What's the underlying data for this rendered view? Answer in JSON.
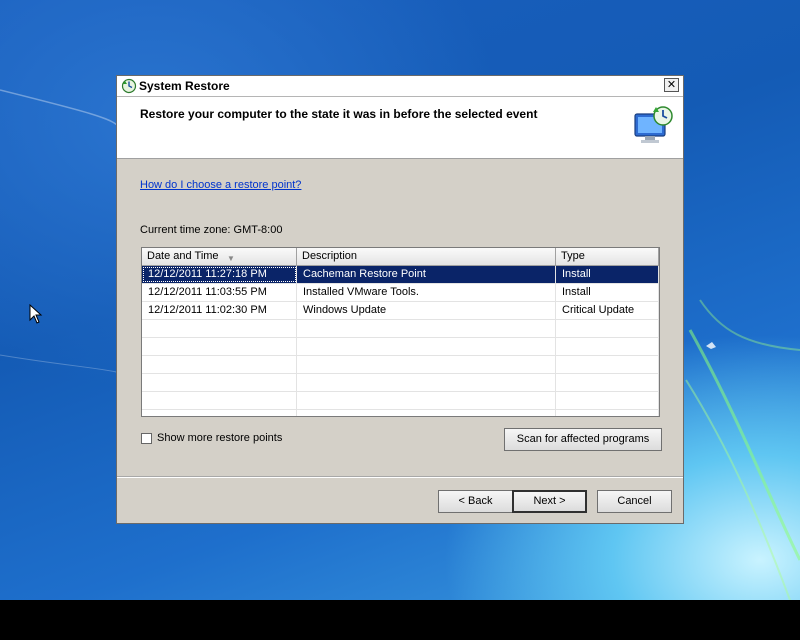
{
  "window": {
    "title": "System Restore",
    "close_label": "✕",
    "header_text": "Restore your computer to the state it was in before the selected event",
    "help_link": "How do I choose a restore point?",
    "timezone": "Current time zone: GMT-8:00"
  },
  "table": {
    "columns": [
      "Date and Time",
      "Description",
      "Type"
    ],
    "rows": [
      [
        "12/12/2011 11:27:18 PM",
        "Cacheman Restore Point",
        "Install"
      ],
      [
        "12/12/2011 11:03:55 PM",
        "Installed VMware Tools.",
        "Install"
      ],
      [
        "12/12/2011 11:02:30 PM",
        "Windows Update",
        "Critical Update"
      ]
    ],
    "selected_row": 0,
    "sort_indicator": "▼"
  },
  "options": {
    "show_more_label": "Show more restore points",
    "show_more_checked": false
  },
  "buttons": {
    "scan": "Scan for affected programs",
    "back": "< Back",
    "next": "Next >",
    "cancel": "Cancel"
  },
  "icons": {
    "title_icon": "system-restore-icon",
    "header_icon": "computer-restore-icon"
  },
  "colors": {
    "selection": "#0a2468",
    "link": "#0033cc"
  }
}
